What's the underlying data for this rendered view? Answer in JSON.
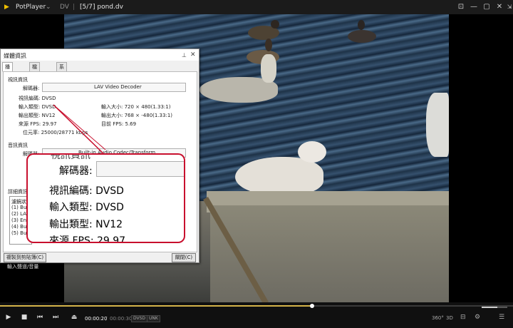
{
  "app": {
    "logo_glyph": "▶",
    "name": "PotPlayer",
    "menu_caret": "⌄",
    "format_badge": "DV",
    "separator": "|",
    "file_title": "[5/7] pond.dv",
    "buttons": {
      "pin": "⊡",
      "min": "—",
      "max": "▢",
      "close": "✕",
      "resize": "⇲"
    }
  },
  "dialog": {
    "title": "媒體資訊",
    "pin_glyph": "⊥",
    "close_glyph": "✕",
    "tabs": [
      "播放資訊",
      "檔案資訊",
      "系統資訊"
    ],
    "video_section": "視訊資訊",
    "decoder_label": "解碼器:",
    "decoder_value": "LAV Video Decoder",
    "video_codec": "視訊編碼: DVSD",
    "input_type": "輸入類型: DVSD",
    "output_type": "輸出類型: NV12",
    "source_fps": "來源 FPS: 29.97",
    "bitrate": "位元率: 25000/28771 kbps",
    "input_size": "輸入大小: 720 × 480(1.33:1)",
    "output_size": "輸出大小: 768 × -480(1.33:1)",
    "current_fps": "目前 FPS: 5.69",
    "audio_section": "音訊資訊",
    "audio_decoder_value": "Built-in Audio Codec/Transform",
    "detail_section": "詳細資訊",
    "detail_items": [
      "濾鏡狀態",
      "(1) Bu",
      "(2) LAV",
      "(3) Ent",
      "(4) Bu",
      "(5) Bu"
    ],
    "copy_button": "複製到剪貼簿(C)",
    "close_button": "關閉(C)",
    "footer_label": "輸入聲道/音量"
  },
  "callout": {
    "partial_heading": "視訊資訊",
    "decoder_label": "解碼器:",
    "video_codec": "視訊編碼: DVSD",
    "input_type": "輸入類型: DVSD",
    "output_type": "輸出類型: NV12",
    "partial_fps": "來源 FPS: 29.97"
  },
  "player": {
    "current_time": "00:00:20",
    "time_sep": "/",
    "total_time": "00:00:30",
    "badges": [
      "DVSD",
      "UNK"
    ],
    "progress_fraction": 0.608,
    "volume_fraction": 0.6,
    "right_icons": [
      "360°",
      "3D",
      "⊟",
      "⚙",
      "☰"
    ]
  },
  "colors": {
    "accent": "#d4b44a",
    "callout_border": "#c8102e"
  }
}
